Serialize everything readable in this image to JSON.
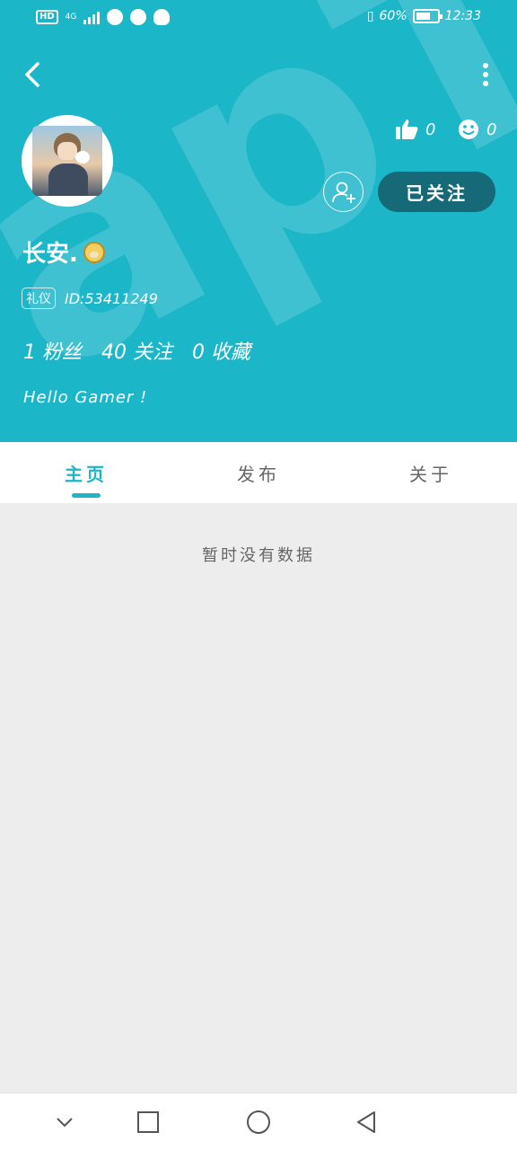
{
  "status_bar": {
    "hd": "HD",
    "network": "4G",
    "battery": "60%",
    "time": "12:33"
  },
  "profile": {
    "name": "长安.",
    "badge": "礼仪",
    "uid": "ID:53411249",
    "likes": "0",
    "smiles": "0",
    "fans_count": "1",
    "fans_label": "粉丝",
    "following_count": "40",
    "following_label": "关注",
    "favorites_count": "0",
    "favorites_label": "收藏",
    "bio": "Hello Gamer !"
  },
  "actions": {
    "follow_label": "已关注"
  },
  "tabs": [
    {
      "label": "主页",
      "active": true
    },
    {
      "label": "发布",
      "active": false
    },
    {
      "label": "关于",
      "active": false
    }
  ],
  "content": {
    "empty_text": "暂时没有数据"
  },
  "colors": {
    "accent": "#1cb6c9",
    "follow_button": "#166977",
    "background": "#ededed"
  },
  "icons": {
    "back": "chevron-left-icon",
    "more": "more-vertical-icon",
    "like": "thumbs-up-icon",
    "smile": "smile-icon",
    "add_friend": "add-user-icon"
  }
}
